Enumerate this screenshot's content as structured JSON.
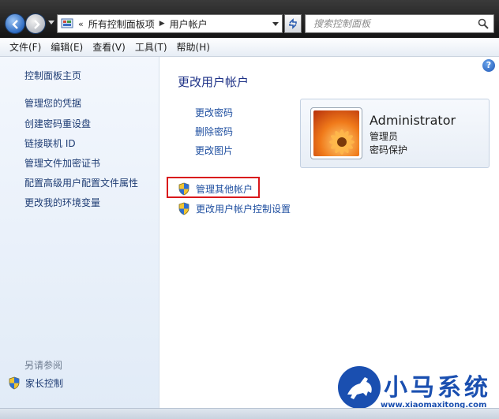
{
  "address_bar": {
    "breadcrumb": [
      "所有控制面板项",
      "用户帐户"
    ],
    "search_placeholder": "搜索控制面板"
  },
  "menu": [
    "文件(F)",
    "编辑(E)",
    "查看(V)",
    "工具(T)",
    "帮助(H)"
  ],
  "left_pane": {
    "home_link": "控制面板主页",
    "links": [
      "管理您的凭据",
      "创建密码重设盘",
      "链接联机 ID",
      "管理文件加密证书",
      "配置高级用户配置文件属性",
      "更改我的环境变量"
    ],
    "see_also_heading": "另请参阅",
    "see_also_links": [
      "家长控制"
    ]
  },
  "main": {
    "title": "更改用户帐户",
    "tasks": [
      "更改密码",
      "删除密码",
      "更改图片"
    ],
    "admin_tasks": [
      "管理其他帐户",
      "更改用户帐户控制设置"
    ],
    "help_glyph": "?",
    "account": {
      "name": "Administrator",
      "role": "管理员",
      "status": "密码保护"
    }
  },
  "watermark": {
    "title": "小马系统",
    "url": "www.xiaomaxitong.com"
  },
  "colors": {
    "link": "#1f4fa0",
    "title": "#1e3287",
    "highlight": "#d9171b",
    "left_pane_bg": "#e9f0f9"
  }
}
